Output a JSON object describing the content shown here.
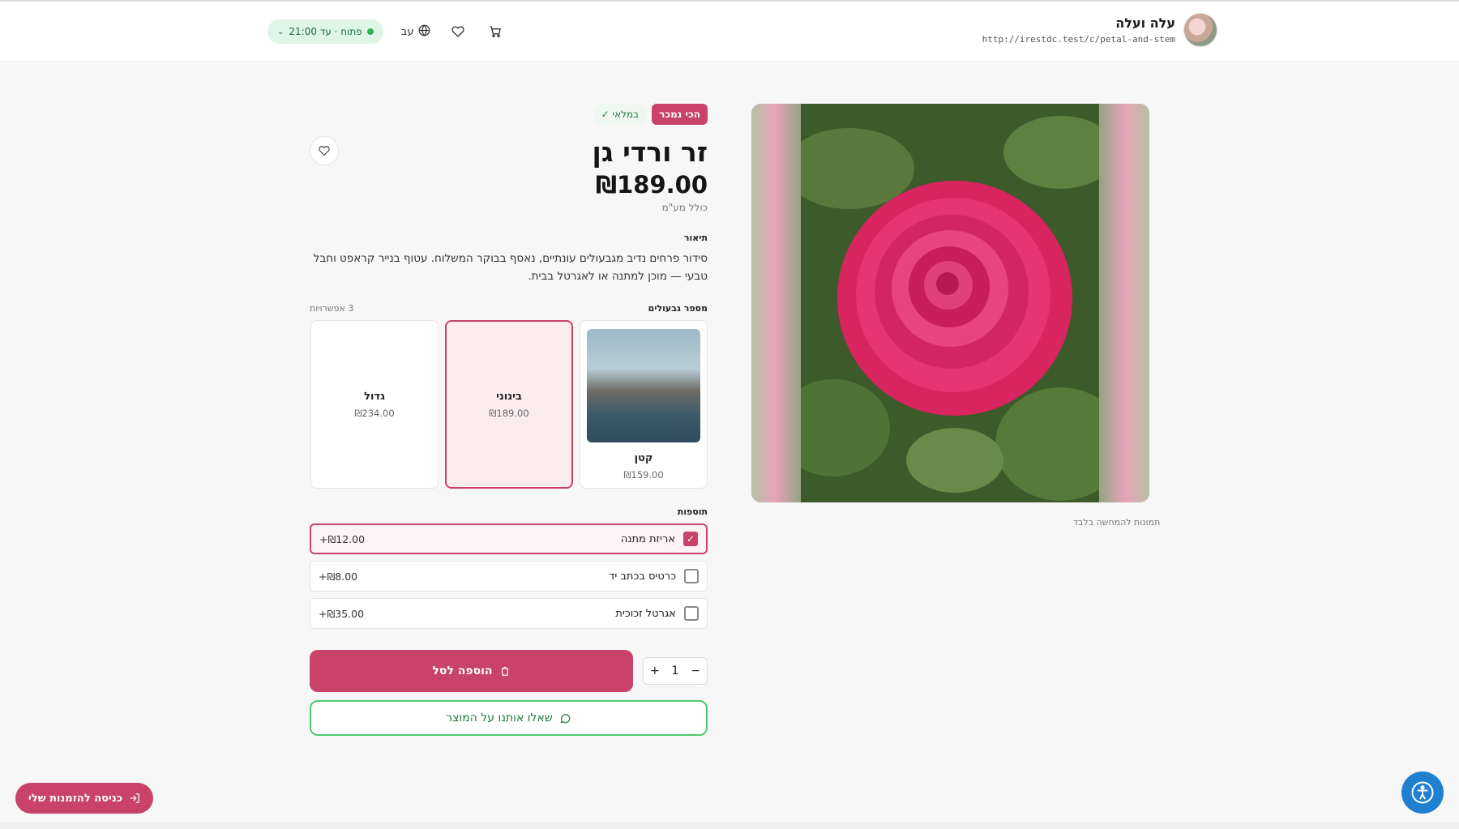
{
  "header": {
    "brand_name": "עלה ועלה",
    "brand_url": "http://irestdc.test/c/petal-and-stem",
    "hours_label": "פתוח · עד 21:00",
    "language_label": "עב"
  },
  "hero": {
    "caption": "תמונות להמחשה בלבד"
  },
  "product": {
    "badge_bestseller": "הכי נמכר",
    "badge_stock": "במלאי",
    "title": "זר ורדי גן",
    "price": "₪189.00",
    "vat_note": "כולל מע\"מ",
    "description_label": "תיאור",
    "description": "סידור פרחים נדיב מגבעולים עונתיים, נאסף בבוקר המשלוח. עטוף בנייר קראפט וחבל טבעי — מוכן למתנה או לאגרטל בבית."
  },
  "sizes": {
    "label": "מספר גבעולים",
    "count": "3 אפשרויות",
    "items": [
      {
        "name": "קטן",
        "price": "₪159.00"
      },
      {
        "name": "בינוני",
        "price": "₪189.00"
      },
      {
        "name": "גדול",
        "price": "₪234.00"
      }
    ]
  },
  "addons": {
    "label": "תוספות",
    "items": [
      {
        "name": "אריזת מתנה",
        "price": "+₪12.00"
      },
      {
        "name": "כרטיס בכתב יד",
        "price": "+₪8.00"
      },
      {
        "name": "אגרטל זכוכית",
        "price": "+₪35.00"
      }
    ]
  },
  "cart": {
    "quantity": "1",
    "plus": "+",
    "minus": "−",
    "add_label": "הוספה לסל",
    "whatsapp_label": "שאלו אותנו על המוצר"
  },
  "footer": {
    "orders_label": "כניסה להזמנות שלי"
  },
  "colors": {
    "accent": "#c8426a",
    "whatsapp": "#4ccb6e",
    "open_status": "#2fb35a",
    "a11y": "#1f7fd1"
  }
}
